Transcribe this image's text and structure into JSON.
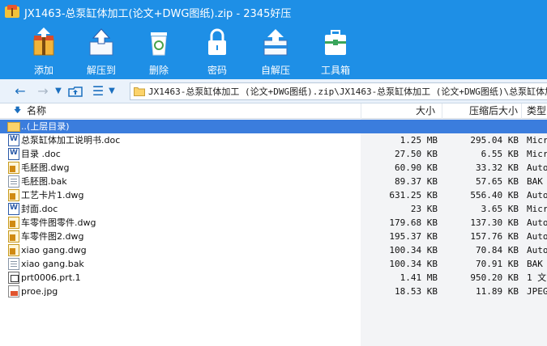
{
  "window": {
    "title": "JX1463-总泵缸体加工(论文+DWG图纸).zip - 2345好压"
  },
  "toolbar": {
    "items": [
      {
        "label": "添加",
        "icon": "add-archive-icon"
      },
      {
        "label": "解压到",
        "icon": "extract-to-icon"
      },
      {
        "label": "删除",
        "icon": "delete-icon"
      },
      {
        "label": "密码",
        "icon": "lock-icon"
      },
      {
        "label": "自解压",
        "icon": "self-extract-icon"
      },
      {
        "label": "工具箱",
        "icon": "toolbox-icon"
      }
    ]
  },
  "address": {
    "path": "JX1463-总泵缸体加工 (论文+DWG图纸).zip\\JX1463-总泵缸体加工 (论文+DWG图纸)\\总泵缸体加"
  },
  "columns": {
    "name": "名称",
    "size": "大小",
    "packed": "压缩后大小",
    "type": "类型"
  },
  "parent_row": {
    "name": "..(上层目录)"
  },
  "files": [
    {
      "name": "总泵缸体加工说明书.doc",
      "size": "1.25 MB",
      "packed": "295.04 KB",
      "type": "Micr",
      "icon": "word-doc-icon"
    },
    {
      "name": "目录 .doc",
      "size": "27.50 KB",
      "packed": "6.55 KB",
      "type": "Micr",
      "icon": "word-doc-icon"
    },
    {
      "name": "毛胚图.dwg",
      "size": "60.90 KB",
      "packed": "33.32 KB",
      "type": "Auto",
      "icon": "dwg-file-icon"
    },
    {
      "name": "毛胚图.bak",
      "size": "89.37 KB",
      "packed": "57.65 KB",
      "type": "BAK",
      "icon": "bak-file-icon"
    },
    {
      "name": "工艺卡片1.dwg",
      "size": "631.25 KB",
      "packed": "556.40 KB",
      "type": "Auto",
      "icon": "dwg-file-icon"
    },
    {
      "name": "封面.doc",
      "size": "23 KB",
      "packed": "3.65 KB",
      "type": "Micr",
      "icon": "word-doc-icon"
    },
    {
      "name": "车零件图零件.dwg",
      "size": "179.68 KB",
      "packed": "137.30 KB",
      "type": "Auto",
      "icon": "dwg-file-icon"
    },
    {
      "name": "车零件图2.dwg",
      "size": "195.37 KB",
      "packed": "157.76 KB",
      "type": "Auto",
      "icon": "dwg-file-icon"
    },
    {
      "name": "xiao gang.dwg",
      "size": "100.34 KB",
      "packed": "70.84 KB",
      "type": "Auto",
      "icon": "dwg-file-icon"
    },
    {
      "name": "xiao gang.bak",
      "size": "100.34 KB",
      "packed": "70.91 KB",
      "type": "BAK",
      "icon": "bak-file-icon"
    },
    {
      "name": "prt0006.prt.1",
      "size": "1.41 MB",
      "packed": "950.20 KB",
      "type": "1 文",
      "icon": "prt-file-icon"
    },
    {
      "name": "proe.jpg",
      "size": "18.53 KB",
      "packed": "11.89 KB",
      "type": "JPEG",
      "icon": "jpg-file-icon"
    }
  ]
}
